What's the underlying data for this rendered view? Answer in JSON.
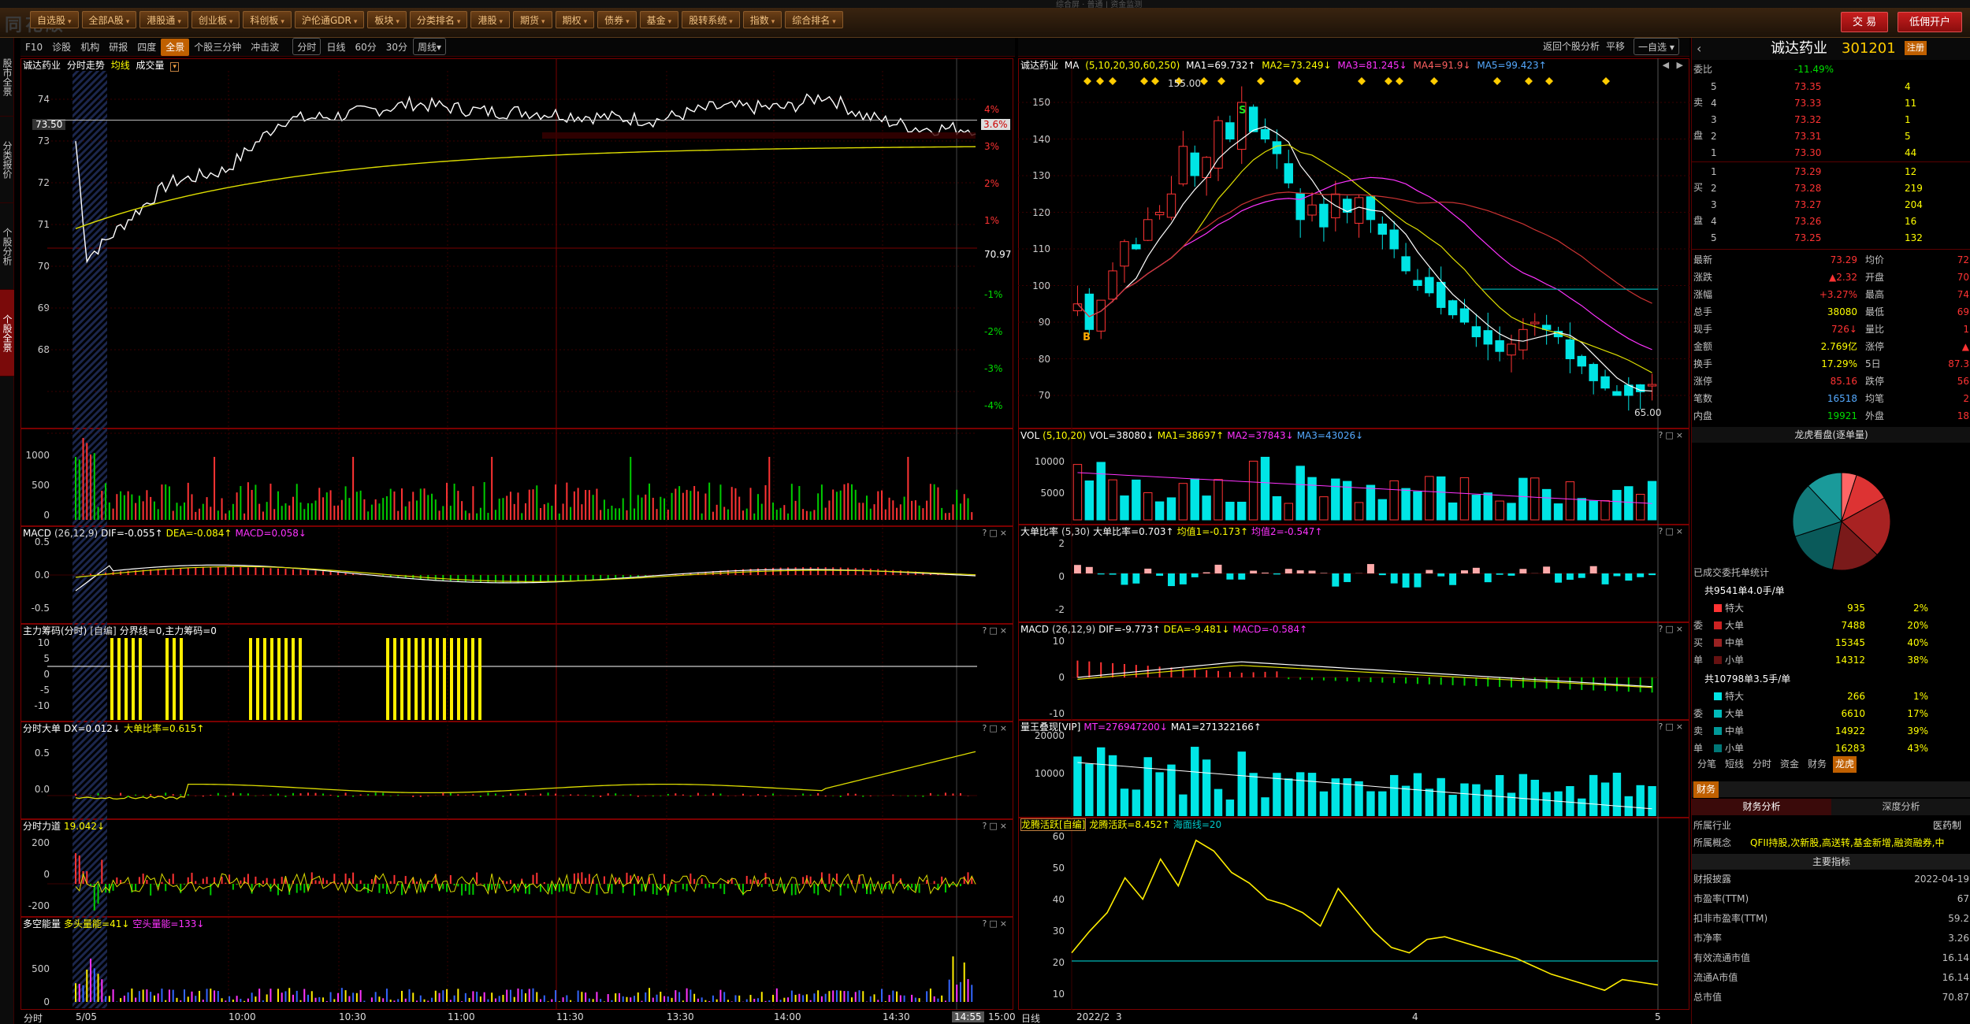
{
  "window": {
    "title": "综合屏  ·  普通  |  资金监测"
  },
  "app_logo": "同花顺",
  "menu": [
    "自选股",
    "全部A股",
    "港股通",
    "创业板",
    "科创板",
    "沪伦通GDR",
    "板块",
    "分类排名",
    "港股",
    "期货",
    "期权",
    "债券",
    "基金",
    "股转系统",
    "指数",
    "综合排名"
  ],
  "right_buttons": {
    "trade": "交 易",
    "margin": "低佣开户"
  },
  "side_tabs": [
    "股市全景",
    "分类报价",
    "个股分析",
    "个股全景"
  ],
  "left_tabs": [
    "F10",
    "诊股",
    "机构",
    "研报",
    "四度",
    "全景",
    "个股三分钟",
    "冲击波"
  ],
  "left_period_tabs": [
    "分时",
    "日线",
    "60分",
    "30分",
    "周线▾"
  ],
  "right_tabs": {
    "back": "返回个股分析",
    "mode": "平移",
    "auto": "一自选 ▾"
  },
  "intraday": {
    "stock": "诚达药业",
    "mode": "分时走势",
    "legend_avg": "均线",
    "legend_vol": "成交量",
    "y_labels": [
      "74",
      "73",
      "72",
      "71",
      "70",
      "69",
      "68"
    ],
    "pct_labels": [
      "4%",
      "3%",
      "2%",
      "1%",
      "",
      "-1%",
      "-2%",
      "-3%",
      "-4%"
    ],
    "price_tag": "73.50",
    "pct_tag": "3.6%",
    "mid_value": "70.97",
    "vol_labels": [
      "1000",
      "500",
      "0"
    ],
    "x_labels": [
      "5/05",
      "10:00",
      "10:30",
      "11:00",
      "11:30",
      "13:30",
      "14:00",
      "14:30",
      "14:55",
      "15:00"
    ],
    "x_left": "分时"
  },
  "sub_panels": {
    "macd": {
      "name": "MACD",
      "params": "(26,12,9)",
      "dif": "DIF=-0.055↑",
      "dea": "DEA=-0.084↑",
      "macd": "MACD=0.058↓",
      "ticks": [
        "0.5",
        "0.0",
        "-0.5"
      ]
    },
    "zlcm": {
      "name": "主力筹码(分时)",
      "tag": "[自编]",
      "text": "分界线=0,主力筹码=0",
      "ticks": [
        "10",
        "5",
        "0",
        "-5",
        "-10"
      ]
    },
    "fsdd": {
      "name": "分时大单",
      "dx": "DX=0.012↓",
      "ddbl": "大单比率=0.615↑",
      "ticks": [
        "0.5",
        "0.0"
      ]
    },
    "fsld": {
      "name": "分时力道",
      "val": "19.042↓",
      "ticks": [
        "200",
        "0",
        "-200"
      ]
    },
    "dkln": {
      "name": "多空能量",
      "dt": "多头量能=41↓",
      "kt": "空头量能=133↓",
      "ticks": [
        "500",
        "0"
      ]
    }
  },
  "kline": {
    "stock": "诚达药业",
    "ma_label": "MA",
    "ma_params": "(5,10,20,30,60,250)",
    "ma1": "MA1=69.732↑",
    "ma2": "MA2=73.249↓",
    "ma3": "MA3=81.245↓",
    "ma4": "MA4=91.9↓",
    "ma5": "MA5=99.423↑",
    "high_label": "155.00",
    "low_label": "65.00",
    "y_labels": [
      "150",
      "140",
      "130",
      "120",
      "110",
      "100",
      "90",
      "80",
      "70"
    ],
    "b_mark": "B",
    "s_mark": "S",
    "x_labels": [
      "2022/2",
      "3",
      "4",
      "5"
    ],
    "x_left": "日线"
  },
  "vol_panel": {
    "name": "VOL",
    "params": "(5,10,20)",
    "vol": "VOL=38080↓",
    "ma1": "MA1=38697↑",
    "ma2": "MA2=37843↓",
    "ma3": "MA3=43026↓",
    "ticks": [
      "10000",
      "5000"
    ]
  },
  "ddbl_panel": {
    "name": "大单比率",
    "params": "(5,30)",
    "v1": "大单比率=0.703↑",
    "v2": "均值1=-0.173↑",
    "v3": "均值2=-0.547↑",
    "ticks": [
      "2",
      "0",
      "-2"
    ]
  },
  "macd_day": {
    "name": "MACD",
    "params": "(26,12,9)",
    "dif": "DIF=-9.773↑",
    "dea": "DEA=-9.481↓",
    "macd": "MACD=-0.584↑",
    "ticks": [
      "10",
      "0",
      "-10"
    ]
  },
  "lw_panel": {
    "name": "量王叠现[VIP]",
    "mt": "MT=276947200↓",
    "ma1": "MA1=271322166↑",
    "ticks": [
      "20000",
      "10000"
    ]
  },
  "lt_panel": {
    "name": "龙腾活跃[自编]",
    "v1": "龙腾活跃=8.452↑",
    "v2": "海面线=20",
    "ticks": [
      "60",
      "50",
      "40",
      "30",
      "20",
      "10"
    ]
  },
  "quote": {
    "name": "诚达药业",
    "code": "301201",
    "badge": "注册",
    "webi_label": "委比",
    "webi": "-11.49%",
    "asks": [
      [
        "5",
        "73.35",
        "4"
      ],
      [
        "4",
        "73.33",
        "11"
      ],
      [
        "3",
        "73.32",
        "1"
      ],
      [
        "2",
        "73.31",
        "5"
      ],
      [
        "1",
        "73.30",
        "44"
      ]
    ],
    "bids": [
      [
        "1",
        "73.29",
        "12"
      ],
      [
        "2",
        "73.28",
        "219"
      ],
      [
        "3",
        "73.27",
        "204"
      ],
      [
        "4",
        "73.26",
        "16"
      ],
      [
        "5",
        "73.25",
        "132"
      ]
    ],
    "side_sell": [
      "卖",
      "盘"
    ],
    "side_buy": [
      "买",
      "盘"
    ],
    "stats": [
      [
        "最新",
        "73.29",
        "均价",
        "72"
      ],
      [
        "涨跌",
        "▲2.32",
        "开盘",
        "70"
      ],
      [
        "涨幅",
        "+3.27%",
        "最高",
        "74"
      ],
      [
        "总手",
        "38080",
        "最低",
        "69"
      ],
      [
        "现手",
        "726↓",
        "量比",
        "1"
      ],
      [
        "金额",
        "2.769亿",
        "涨停",
        "▲"
      ],
      [
        "换手",
        "17.29%",
        "5日",
        "87.3"
      ],
      [
        "涨停",
        "85.16",
        "跌停",
        "56"
      ],
      [
        "笔数",
        "16518",
        "均笔",
        "2"
      ],
      [
        "内盘",
        "19921",
        "外盘",
        "18"
      ]
    ]
  },
  "pie": {
    "title": "龙虎看盘(逐单量)"
  },
  "orders": {
    "title": "已成交委托单统计",
    "buy_hdr": "共9541单4.0手/单",
    "buy": [
      [
        "特大",
        "935",
        "2%"
      ],
      [
        "大单",
        "7488",
        "20%"
      ],
      [
        "中单",
        "15345",
        "40%"
      ],
      [
        "小单",
        "14312",
        "38%"
      ]
    ],
    "buy_side": [
      "委",
      "买",
      "单"
    ],
    "sell_hdr": "共10798单3.5手/单",
    "sell": [
      [
        "特大",
        "266",
        "1%"
      ],
      [
        "大单",
        "6610",
        "17%"
      ],
      [
        "中单",
        "14922",
        "39%"
      ],
      [
        "小单",
        "16283",
        "43%"
      ]
    ],
    "sell_side": [
      "委",
      "卖",
      "单"
    ]
  },
  "bottom_tabs": [
    "分笔",
    "短线",
    "分时",
    "资金",
    "财务",
    "龙虎"
  ],
  "fin": {
    "tab": "财务",
    "sub_tabs": [
      "财务分析",
      "深度分析"
    ],
    "industry_label": "所属行业",
    "industry": "医药制",
    "concept_label": "所属概念",
    "concept": "QFII持股,次新股,高送转,基金新增,融资融券,中",
    "main_title": "主要指标",
    "items": [
      [
        "财报披露",
        "2022-04-19"
      ],
      [
        "市盈率(TTM)",
        "67"
      ],
      [
        "扣非市盈率(TTM)",
        "59.2"
      ],
      [
        "市净率",
        "3.26"
      ],
      [
        "有效流通市值",
        "16.14"
      ],
      [
        "流通A市值",
        "16.14"
      ],
      [
        "总市值",
        "70.87"
      ]
    ]
  },
  "colors": {
    "up": "#ff3333",
    "down": "#00e5e5",
    "accent": "#c06000",
    "border": "#7a0000"
  }
}
